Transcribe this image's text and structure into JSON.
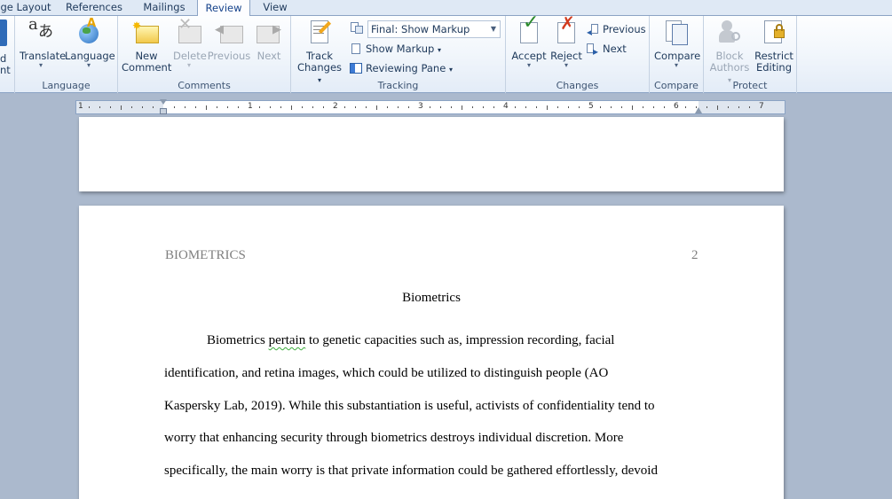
{
  "tabs": [
    "ge Layout",
    "References",
    "Mailings",
    "Review",
    "View"
  ],
  "active_tab": "Review",
  "ribbon": {
    "proofing_partial": {
      "line1": "d",
      "line2": "nt"
    },
    "language_group": {
      "label": "Language",
      "translate": "Translate",
      "language": "Language"
    },
    "comments_group": {
      "label": "Comments",
      "new_comment_line1": "New",
      "new_comment_line2": "Comment",
      "delete": "Delete",
      "previous": "Previous",
      "next": "Next"
    },
    "tracking_group": {
      "label": "Tracking",
      "track_changes_line1": "Track",
      "track_changes_line2": "Changes",
      "display_for_review": "Final: Show Markup",
      "show_markup": "Show Markup",
      "reviewing_pane": "Reviewing Pane"
    },
    "changes_group": {
      "label": "Changes",
      "accept": "Accept",
      "reject": "Reject",
      "previous": "Previous",
      "next": "Next"
    },
    "compare_group": {
      "label": "Compare",
      "compare": "Compare"
    },
    "protect_group": {
      "label": "Protect",
      "block_authors_line1": "Block",
      "block_authors_line2": "Authors",
      "restrict_editing_line1": "Restrict",
      "restrict_editing_line2": "Editing"
    }
  },
  "ruler": {
    "numbers": [
      "1",
      "1",
      "2",
      "3",
      "4",
      "5",
      "6",
      "7"
    ]
  },
  "document": {
    "header_left": "BIOMETRICS",
    "header_right": "2",
    "title": "Biometrics",
    "lines": [
      {
        "before": "Biometrics ",
        "flagged": "pertain",
        "after": " to genetic capacities such as, impression recording, facial"
      },
      {
        "text": "identification, and retina images, which could be utilized to distinguish people (AO"
      },
      {
        "text": "Kaspersky Lab, 2019). While this substantiation is useful, activists of confidentiality tend to"
      },
      {
        "text": "worry that enhancing security through biometrics  destroys individual discretion. More"
      },
      {
        "text": "specifically,  the main worry is that private information could be gathered effortlessly, devoid"
      }
    ]
  },
  "colors": {
    "workspace": "#abb9cd",
    "ribbon_text": "#1e395b",
    "header_text": "#7f7f7f",
    "squiggle": "#3cac3c"
  }
}
